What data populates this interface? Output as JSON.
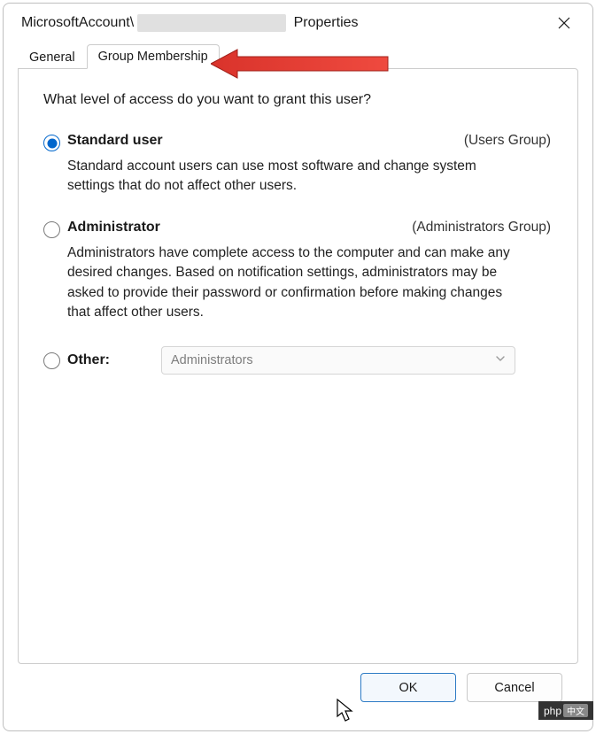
{
  "window": {
    "title_prefix": "MicrosoftAccount\\",
    "title_suffix": " Properties"
  },
  "tabs": {
    "general": "General",
    "group_membership": "Group Membership"
  },
  "panel": {
    "question": "What level of access do you want to grant this user?",
    "options": {
      "standard": {
        "label": "Standard user",
        "group": "(Users Group)",
        "description": "Standard account users can use most software and change system settings that do not affect other users.",
        "selected": true
      },
      "administrator": {
        "label": "Administrator",
        "group": "(Administrators Group)",
        "description": "Administrators have complete access to the computer and can make any desired changes. Based on notification settings, administrators may be asked to provide their password or confirmation before making changes that affect other users.",
        "selected": false
      },
      "other": {
        "label": "Other:",
        "combo_value": "Administrators",
        "selected": false
      }
    }
  },
  "buttons": {
    "ok": "OK",
    "cancel": "Cancel"
  },
  "watermark": {
    "text": "php"
  }
}
